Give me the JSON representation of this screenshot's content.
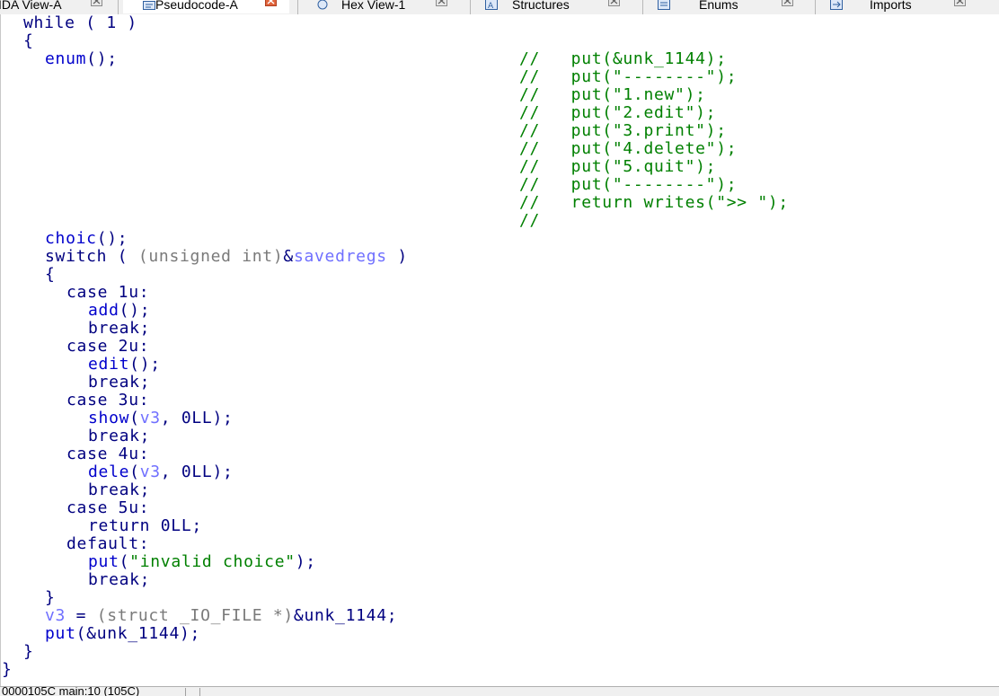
{
  "tabs": [
    {
      "label": "IDA View-A",
      "active": false,
      "icon": "ida-view-icon"
    },
    {
      "label": "Pseudocode-A",
      "active": true,
      "icon": "pseudocode-icon"
    },
    {
      "label": "Hex View-1",
      "active": false,
      "icon": "hex-view-icon"
    },
    {
      "label": "Structures",
      "active": false,
      "icon": "structures-icon"
    },
    {
      "label": "Enums",
      "active": false,
      "icon": "enums-icon"
    },
    {
      "label": "Imports",
      "active": false,
      "icon": "imports-icon"
    }
  ],
  "code": {
    "l01": {
      "a": "while",
      "b": " ( ",
      "c": "1",
      "d": " )"
    },
    "l02": {
      "a": "{"
    },
    "l03": {
      "a": "enum",
      "b": "();"
    },
    "l04": {
      "a": "choic",
      "b": "();"
    },
    "l05": {
      "a": "switch",
      "b": " ( ",
      "c": "(unsigned int)",
      "d": "&",
      "e": "savedregs",
      "f": " )"
    },
    "l06": {
      "a": "{"
    },
    "l07": {
      "a": "case 1u:"
    },
    "l08": {
      "a": "add",
      "b": "();"
    },
    "l09": {
      "a": "break;"
    },
    "l10": {
      "a": "case 2u:"
    },
    "l11": {
      "a": "edit",
      "b": "();"
    },
    "l12": {
      "a": "break;"
    },
    "l13": {
      "a": "case 3u:"
    },
    "l14": {
      "a": "show",
      "b": "(",
      "c": "v3",
      "d": ", 0LL);"
    },
    "l15": {
      "a": "break;"
    },
    "l16": {
      "a": "case 4u:"
    },
    "l17": {
      "a": "dele",
      "b": "(",
      "c": "v3",
      "d": ", 0LL);"
    },
    "l18": {
      "a": "break;"
    },
    "l19": {
      "a": "case 5u:"
    },
    "l20": {
      "a": "return 0LL;"
    },
    "l21": {
      "a": "default:"
    },
    "l22": {
      "a": "put",
      "b": "(",
      "c": "\"invalid choice\"",
      "d": ");"
    },
    "l23": {
      "a": "break;"
    },
    "l24": {
      "a": "}"
    },
    "l25": {
      "a": "v3",
      "b": " = ",
      "c": "(struct _IO_FILE *)",
      "d": "&unk_1144;"
    },
    "l26": {
      "a": "put",
      "b": "(&unk_1144);"
    },
    "l27": {
      "a": "}"
    },
    "l28": {
      "a": "}"
    }
  },
  "comments": [
    "//   put(&unk_1144);",
    "//   put(\"--------\");",
    "//   put(\"1.new\");",
    "//   put(\"2.edit\");",
    "//   put(\"3.print\");",
    "//   put(\"4.delete\");",
    "//   put(\"5.quit\");",
    "//   put(\"--------\");",
    "//   return writes(\">> \");",
    "//"
  ],
  "status": {
    "text": "0000105C main:10 (105C)"
  },
  "colors": {
    "keyword": "#000080",
    "function": "#0000cc",
    "variable": "#7070ff",
    "comment": "#008000",
    "type": "#7a7a7a"
  }
}
